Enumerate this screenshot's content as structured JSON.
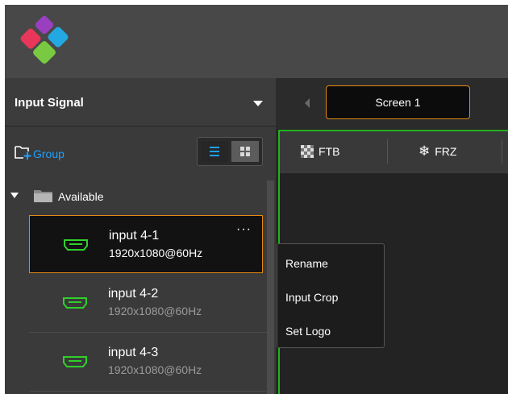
{
  "colors": {
    "accent": "#e28a10",
    "link": "#1ea0ff",
    "screen_border": "#23b21c",
    "signal_icon": "#2fd02a"
  },
  "input_signal": {
    "title": "Input Signal",
    "group_label": "Group"
  },
  "tree": {
    "folder_label": "Available",
    "items": [
      {
        "name": "input 4-1",
        "resolution": "1920x1080@60Hz",
        "selected": true
      },
      {
        "name": "input 4-2",
        "resolution": "1920x1080@60Hz",
        "selected": false
      },
      {
        "name": "input 4-3",
        "resolution": "1920x1080@60Hz",
        "selected": false
      }
    ]
  },
  "screen": {
    "tab_label": "Screen 1",
    "toolbar": {
      "ftb_label": "FTB",
      "frz_label": "FRZ"
    }
  },
  "context_menu": {
    "items": [
      "Rename",
      "Input Crop",
      "Set Logo"
    ]
  },
  "icons": [
    "logo-icon",
    "chevron-down-icon",
    "add-group-icon",
    "list-view-icon",
    "grid-view-icon",
    "folder-icon",
    "hdmi-icon",
    "more-icon",
    "chevron-left-icon",
    "ftb-icon",
    "snowflake-icon"
  ]
}
